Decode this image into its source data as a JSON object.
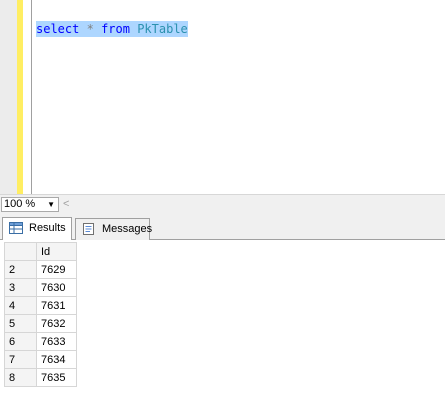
{
  "editor": {
    "tokens": {
      "select": "select",
      "star": "*",
      "from": "from",
      "table": "PkTable"
    }
  },
  "status": {
    "zoom_value": "100 %",
    "zoom_options": [
      "100 %"
    ]
  },
  "tabs": [
    {
      "label": "Results",
      "icon": "grid-icon",
      "selected": true
    },
    {
      "label": "Messages",
      "icon": "message-icon",
      "selected": false
    }
  ],
  "results": {
    "columns": [
      "Id"
    ],
    "rows": [
      {
        "row": "2",
        "id": "7629"
      },
      {
        "row": "3",
        "id": "7630"
      },
      {
        "row": "4",
        "id": "7631"
      },
      {
        "row": "5",
        "id": "7632"
      },
      {
        "row": "6",
        "id": "7633"
      },
      {
        "row": "7",
        "id": "7634"
      },
      {
        "row": "8",
        "id": "7635"
      }
    ]
  },
  "colors": {
    "keyword": "#0000ff",
    "operator": "#808080",
    "identifier": "#2b91af",
    "selection": "#add6ff",
    "change_bar": "#ffee62"
  }
}
